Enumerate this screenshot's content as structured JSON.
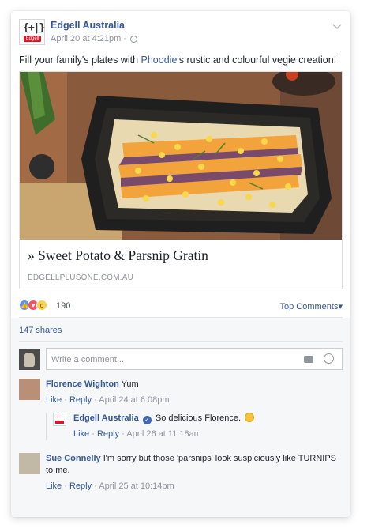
{
  "post": {
    "page_name": "Edgell Australia",
    "timestamp": "April 20 at 4:21pm",
    "separator": "·",
    "logo_text": "{+|}",
    "logo_brand": "Edgell",
    "status_pre": "Fill your family's plates with ",
    "status_link": "Phoodie",
    "status_post": "'s rustic and colourful vegie creation!",
    "link_title": "» Sweet Potato & Parsnip Gratin",
    "link_domain": "EDGELLPLUSONE.COM.AU",
    "photo_alt": "Sweet potato and parsnip gratin in a black dish"
  },
  "reactions": {
    "count": "190",
    "icons": [
      "like-icon",
      "love-icon",
      "wow-icon"
    ],
    "top_comments_label": "Top Comments",
    "shares": "147 shares"
  },
  "composer": {
    "placeholder": "Write a comment..."
  },
  "comments": [
    {
      "name": "Florence Wighton",
      "text": "Yum",
      "like": "Like",
      "reply": "Reply",
      "time": "April 24 at 6:08pm",
      "reply_item": {
        "name": "Edgell Australia",
        "text": "So delicious Florence.",
        "like": "Like",
        "reply": "Reply",
        "time": "April 26 at 11:18am"
      }
    },
    {
      "name": "Sue Connelly",
      "text": "I'm sorry but those 'parsnips' look suspiciously like TURNIPS to me.",
      "like": "Like",
      "reply": "Reply",
      "time": "April 25 at 10:14pm"
    }
  ],
  "colors": {
    "link": "#365899",
    "meta": "#90949c",
    "brand_red": "#d7182a"
  }
}
